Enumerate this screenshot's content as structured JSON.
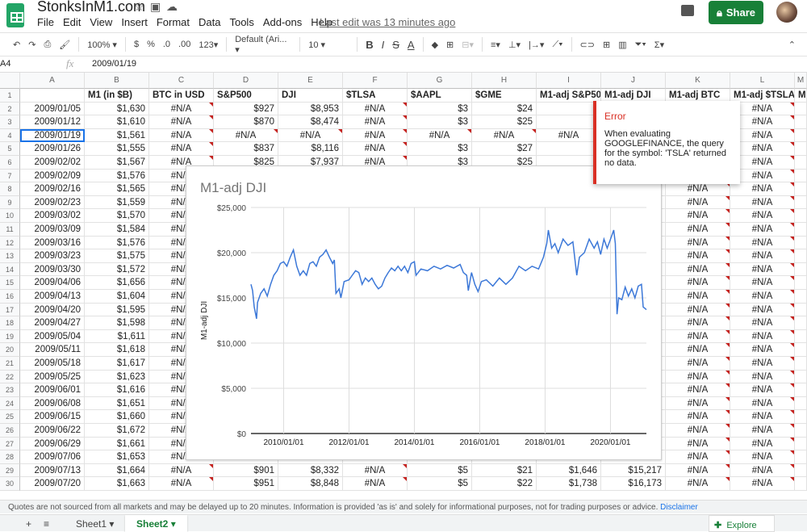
{
  "app": {
    "title": "StonksInM1.com",
    "last_edit": "Last edit was 13 minutes ago",
    "share_label": "Share",
    "menu": [
      "File",
      "Edit",
      "View",
      "Insert",
      "Format",
      "Data",
      "Tools",
      "Add-ons",
      "Help"
    ]
  },
  "toolbar": {
    "zoom": "100%",
    "currency": "$",
    "percent": "%",
    "dec_less": ".0",
    "dec_more": ".00",
    "format_more": "123",
    "font": "Default (Ari...",
    "font_size": "10",
    "bold": "B",
    "italic": "I",
    "strike": "S",
    "text_color": "A"
  },
  "formula_bar": {
    "name_box": "A4",
    "fx": "fx",
    "value": "2009/01/19"
  },
  "columns": [
    "A",
    "B",
    "C",
    "D",
    "E",
    "F",
    "G",
    "H",
    "I",
    "J",
    "K",
    "L",
    "M"
  ],
  "header_row": [
    "",
    "M1 (in $B)",
    "BTC in USD",
    "S&P500",
    "DJI",
    "$TLSA",
    "$AAPL",
    "$GME",
    "M1-adj S&P500",
    "M1-adj DJI",
    "M1-adj BTC",
    "M1-adj $TSLA",
    "M"
  ],
  "rows": [
    [
      "2009/01/05",
      "$1,630",
      "#N/A",
      "$927",
      "$8,953",
      "#N/A",
      "$3",
      "$24",
      "",
      "",
      "",
      "#N/A",
      ""
    ],
    [
      "2009/01/12",
      "$1,610",
      "#N/A",
      "$870",
      "$8,474",
      "#N/A",
      "$3",
      "$25",
      "",
      "",
      "",
      "#N/A",
      ""
    ],
    [
      "2009/01/19",
      "$1,561",
      "#N/A",
      "#N/A",
      "#N/A",
      "#N/A",
      "#N/A",
      "#N/A",
      "#N/A",
      "",
      "",
      "#N/A",
      ""
    ],
    [
      "2009/01/26",
      "$1,555",
      "#N/A",
      "$837",
      "$8,116",
      "#N/A",
      "$3",
      "$27",
      "",
      "",
      "",
      "#N/A",
      ""
    ],
    [
      "2009/02/02",
      "$1,567",
      "#N/A",
      "$825",
      "$7,937",
      "#N/A",
      "$3",
      "$25",
      "",
      "",
      "",
      "#N/A",
      ""
    ],
    [
      "2009/02/09",
      "$1,576",
      "#N/A",
      "",
      "",
      "",
      "",
      "",
      "",
      "",
      "",
      "#N/A",
      ""
    ],
    [
      "2009/02/16",
      "$1,565",
      "#N/A",
      "",
      "",
      "",
      "",
      "",
      "",
      "",
      "#N/A",
      "#N/A",
      ""
    ],
    [
      "2009/02/23",
      "$1,559",
      "#N/A",
      "",
      "",
      "",
      "",
      "",
      "",
      "",
      "#N/A",
      "#N/A",
      ""
    ],
    [
      "2009/03/02",
      "$1,570",
      "#N/A",
      "",
      "",
      "",
      "",
      "",
      "",
      "",
      "#N/A",
      "#N/A",
      ""
    ],
    [
      "2009/03/09",
      "$1,584",
      "#N/A",
      "",
      "",
      "",
      "",
      "",
      "",
      "",
      "#N/A",
      "#N/A",
      ""
    ],
    [
      "2009/03/16",
      "$1,576",
      "#N/A",
      "",
      "",
      "",
      "",
      "",
      "",
      "",
      "#N/A",
      "#N/A",
      ""
    ],
    [
      "2009/03/23",
      "$1,575",
      "#N/A",
      "",
      "",
      "",
      "",
      "",
      "",
      "",
      "#N/A",
      "#N/A",
      ""
    ],
    [
      "2009/03/30",
      "$1,572",
      "#N/A",
      "",
      "",
      "",
      "",
      "",
      "",
      "",
      "#N/A",
      "#N/A",
      ""
    ],
    [
      "2009/04/06",
      "$1,656",
      "#N/A",
      "",
      "",
      "",
      "",
      "",
      "",
      "",
      "#N/A",
      "#N/A",
      ""
    ],
    [
      "2009/04/13",
      "$1,604",
      "#N/A",
      "",
      "",
      "",
      "",
      "",
      "",
      "",
      "#N/A",
      "#N/A",
      ""
    ],
    [
      "2009/04/20",
      "$1,595",
      "#N/A",
      "",
      "",
      "",
      "",
      "",
      "",
      "",
      "#N/A",
      "#N/A",
      ""
    ],
    [
      "2009/04/27",
      "$1,598",
      "#N/A",
      "",
      "",
      "",
      "",
      "",
      "",
      "",
      "#N/A",
      "#N/A",
      ""
    ],
    [
      "2009/05/04",
      "$1,611",
      "#N/A",
      "",
      "",
      "",
      "",
      "",
      "",
      "",
      "#N/A",
      "#N/A",
      ""
    ],
    [
      "2009/05/11",
      "$1,618",
      "#N/A",
      "",
      "",
      "",
      "",
      "",
      "",
      "",
      "#N/A",
      "#N/A",
      ""
    ],
    [
      "2009/05/18",
      "$1,617",
      "#N/A",
      "",
      "",
      "",
      "",
      "",
      "",
      "",
      "#N/A",
      "#N/A",
      ""
    ],
    [
      "2009/05/25",
      "$1,623",
      "#N/A",
      "",
      "",
      "",
      "",
      "",
      "",
      "",
      "#N/A",
      "#N/A",
      ""
    ],
    [
      "2009/06/01",
      "$1,616",
      "#N/A",
      "",
      "",
      "",
      "",
      "",
      "",
      "",
      "#N/A",
      "#N/A",
      ""
    ],
    [
      "2009/06/08",
      "$1,651",
      "#N/A",
      "",
      "",
      "",
      "",
      "",
      "",
      "",
      "#N/A",
      "#N/A",
      ""
    ],
    [
      "2009/06/15",
      "$1,660",
      "#N/A",
      "",
      "",
      "",
      "",
      "",
      "",
      "",
      "#N/A",
      "#N/A",
      ""
    ],
    [
      "2009/06/22",
      "$1,672",
      "#N/A",
      "",
      "",
      "",
      "",
      "",
      "",
      "",
      "#N/A",
      "#N/A",
      ""
    ],
    [
      "2009/06/29",
      "$1,661",
      "#N/A",
      "",
      "",
      "",
      "",
      "",
      "",
      "",
      "#N/A",
      "#N/A",
      ""
    ],
    [
      "2009/07/06",
      "$1,653",
      "#N/A",
      "",
      "",
      "",
      "",
      "",
      "",
      "",
      "#N/A",
      "#N/A",
      ""
    ],
    [
      "2009/07/13",
      "$1,664",
      "#N/A",
      "$901",
      "$8,332",
      "#N/A",
      "$5",
      "$21",
      "$1,646",
      "$15,217",
      "#N/A",
      "#N/A",
      ""
    ],
    [
      "2009/07/20",
      "$1,663",
      "#N/A",
      "$951",
      "$8,848",
      "#N/A",
      "$5",
      "$22",
      "$1,738",
      "$16,173",
      "#N/A",
      "#N/A",
      ""
    ]
  ],
  "error_popup": {
    "title": "Error",
    "message": "When evaluating GOOGLEFINANCE, the query for the symbol: 'TSLA' returned no data."
  },
  "disclaimer": {
    "text": "Quotes are not sourced from all markets and may be delayed up to 20 minutes. Information is provided 'as is' and solely for informational purposes, not for trading purposes or advice.",
    "link": "Disclaimer"
  },
  "sheets": {
    "add": "+",
    "list": "≡",
    "tabs": [
      "Sheet1",
      "Sheet2"
    ],
    "explore": "Explore"
  },
  "colors": {
    "line": "#3c78d8",
    "accent": "#188038",
    "error": "#d93025"
  },
  "chart_data": {
    "type": "line",
    "title": "M1-adj DJI",
    "xlabel": "",
    "ylabel": "M1-adj DJI",
    "ylim": [
      0,
      25000
    ],
    "xlim": [
      2009.0,
      2021.1
    ],
    "yticks": [
      "$0",
      "$5,000",
      "$10,000",
      "$15,000",
      "$20,000",
      "$25,000"
    ],
    "ytick_values": [
      0,
      5000,
      10000,
      15000,
      20000,
      25000
    ],
    "xticks": [
      "2010/01/01",
      "2012/01/01",
      "2014/01/01",
      "2016/01/01",
      "2018/01/01",
      "2020/01/01"
    ],
    "xtick_values": [
      2010,
      2012,
      2014,
      2016,
      2018,
      2020
    ],
    "series": [
      {
        "name": "M1-adj DJI",
        "x": [
          2009.0,
          2009.05,
          2009.1,
          2009.17,
          2009.2,
          2009.3,
          2009.4,
          2009.5,
          2009.6,
          2009.7,
          2009.8,
          2009.9,
          2010.0,
          2010.1,
          2010.2,
          2010.3,
          2010.4,
          2010.5,
          2010.6,
          2010.7,
          2010.8,
          2010.9,
          2011.0,
          2011.1,
          2011.2,
          2011.3,
          2011.4,
          2011.5,
          2011.55,
          2011.6,
          2011.7,
          2011.75,
          2011.85,
          2012.0,
          2012.1,
          2012.2,
          2012.3,
          2012.4,
          2012.5,
          2012.6,
          2012.7,
          2012.8,
          2012.9,
          2013.0,
          2013.1,
          2013.2,
          2013.3,
          2013.4,
          2013.5,
          2013.6,
          2013.7,
          2013.8,
          2013.9,
          2014.0,
          2014.05,
          2014.2,
          2014.4,
          2014.6,
          2014.8,
          2015.0,
          2015.2,
          2015.4,
          2015.5,
          2015.6,
          2015.65,
          2015.75,
          2015.85,
          2015.95,
          2016.05,
          2016.2,
          2016.4,
          2016.6,
          2016.8,
          2017.0,
          2017.2,
          2017.4,
          2017.6,
          2017.8,
          2017.95,
          2018.05,
          2018.1,
          2018.2,
          2018.3,
          2018.4,
          2018.55,
          2018.7,
          2018.85,
          2018.97,
          2019.05,
          2019.2,
          2019.35,
          2019.5,
          2019.6,
          2019.7,
          2019.8,
          2019.9,
          2020.0,
          2020.1,
          2020.15,
          2020.2,
          2020.25,
          2020.35,
          2020.45,
          2020.55,
          2020.65,
          2020.75,
          2020.85,
          2020.95,
          2021.0,
          2021.1
        ],
        "values": [
          16500,
          15800,
          14000,
          12700,
          14500,
          15500,
          16000,
          15200,
          16500,
          17500,
          18000,
          18800,
          19000,
          18500,
          19500,
          20300,
          18500,
          17500,
          18000,
          17500,
          18800,
          19000,
          18500,
          19500,
          19800,
          20300,
          19500,
          18800,
          19200,
          15500,
          16000,
          15000,
          16800,
          17000,
          17500,
          18000,
          17800,
          16500,
          17200,
          16800,
          17200,
          16500,
          16000,
          16300,
          17200,
          17800,
          18300,
          18000,
          18500,
          18000,
          18500,
          17800,
          18800,
          19000,
          17500,
          18200,
          18000,
          18500,
          18200,
          18600,
          18300,
          18700,
          17800,
          17500,
          15800,
          17800,
          16500,
          15700,
          16800,
          17000,
          16300,
          17200,
          16500,
          17200,
          18500,
          18000,
          18500,
          18200,
          19500,
          21000,
          22500,
          20500,
          21000,
          20000,
          21500,
          20800,
          21200,
          17500,
          19500,
          20000,
          21500,
          20500,
          21200,
          19800,
          21500,
          20500,
          21500,
          22500,
          21000,
          13200,
          15000,
          14800,
          16200,
          15200,
          16000,
          15000,
          16300,
          16500,
          14000,
          13700
        ]
      }
    ]
  }
}
